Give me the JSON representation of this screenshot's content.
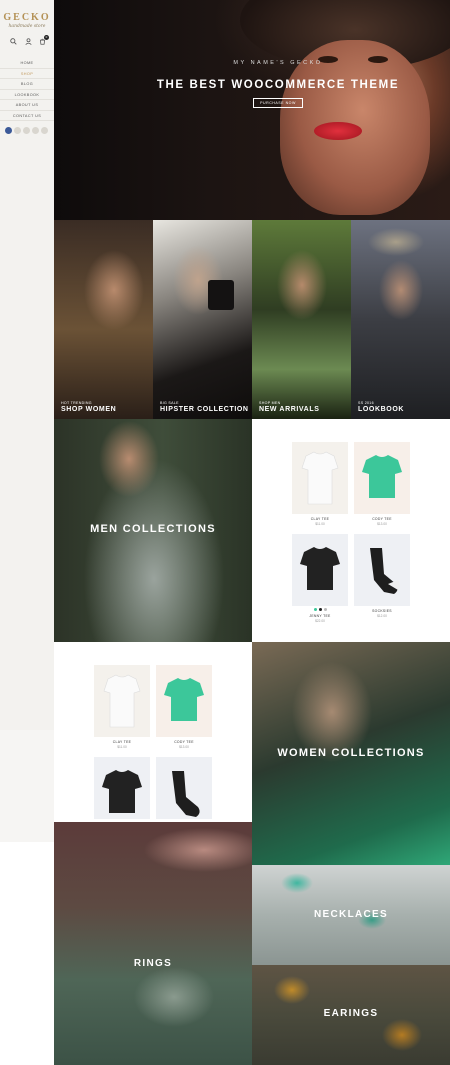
{
  "brand": {
    "logo": "GECKO",
    "tagline": "handmade store"
  },
  "sidebar": {
    "nav": [
      {
        "label": "HOME",
        "active": false
      },
      {
        "label": "SHOP",
        "active": true
      },
      {
        "label": "BLOG",
        "active": false
      },
      {
        "label": "LOOKBOOK",
        "active": false
      },
      {
        "label": "ABOUT US",
        "active": false
      },
      {
        "label": "CONTACT US",
        "active": false
      }
    ],
    "icons": [
      "search-icon",
      "user-icon",
      "cart-icon"
    ],
    "cart_count": "0",
    "socials": [
      "facebook-icon",
      "twitter-icon",
      "google-plus-icon",
      "pinterest-icon",
      "instagram-icon"
    ]
  },
  "hero": {
    "kicker": "MY NAME'S GECKO",
    "title": "THE BEST WOOCOMMERCE THEME",
    "button": "PURCHASE NOW"
  },
  "collections": [
    {
      "kicker": "HOT TRENDING",
      "title": "SHOP WOMEN"
    },
    {
      "kicker": "BIG SALE",
      "title": "HIPSTER COLLECTION"
    },
    {
      "kicker": "SHOP MEN",
      "title": "NEW ARRIVALS"
    },
    {
      "kicker": "SS 2016",
      "title": "LOOKBOOK"
    }
  ],
  "men_banner": {
    "title": "MEN COLLECTIONS"
  },
  "products_right": [
    {
      "name": "CLAY TEE",
      "price": "$11.00"
    },
    {
      "name": "CODY TEE",
      "price": "$13.00"
    },
    {
      "name": "JENNY TEE",
      "price": "$22.00"
    },
    {
      "name": "SOCKSIES",
      "price": "$12.00"
    }
  ],
  "products_left": [
    {
      "name": "CLAY TEE",
      "price": "$11.00"
    },
    {
      "name": "CODY TEE",
      "price": "$13.00"
    }
  ],
  "swatch_colors": [
    "#3cc79a",
    "#222222",
    "#bbbbbb"
  ],
  "women_banner": {
    "title": "WOMEN COLLECTIONS"
  },
  "jewelry": [
    {
      "title": "RINGS"
    },
    {
      "title": "NECKLACES"
    },
    {
      "title": "EARINGS"
    }
  ],
  "colors": {
    "accent": "#c0975a",
    "green": "#3cc79a",
    "sidebar": "#f3f2ef"
  }
}
